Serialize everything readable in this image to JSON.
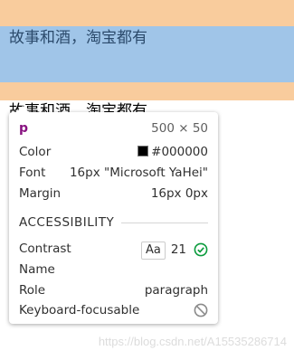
{
  "page": {
    "paragraph_text": "故事和酒，淘宝都有",
    "paragraph_text_partial": "故事和酒，淘宝都有"
  },
  "tooltip": {
    "tag": "p",
    "dimensions": "500 × 50",
    "color_label": "Color",
    "color_value": "#000000",
    "font_label": "Font",
    "font_value": "16px \"Microsoft YaHei\"",
    "margin_label": "Margin",
    "margin_value": "16px 0px",
    "accessibility_heading": "ACCESSIBILITY",
    "contrast_label": "Contrast",
    "contrast_badge": "Aa",
    "contrast_value": "21",
    "name_label": "Name",
    "role_label": "Role",
    "role_value": "paragraph",
    "keyboard_label": "Keyboard-focusable"
  },
  "watermark": "https://blog.csdn.net/A15535286714",
  "colors": {
    "margin_highlight": "#f9cc9d",
    "content_highlight": "#a0c5e8",
    "tag_color": "#881280",
    "check_green": "#0a9b3c"
  }
}
